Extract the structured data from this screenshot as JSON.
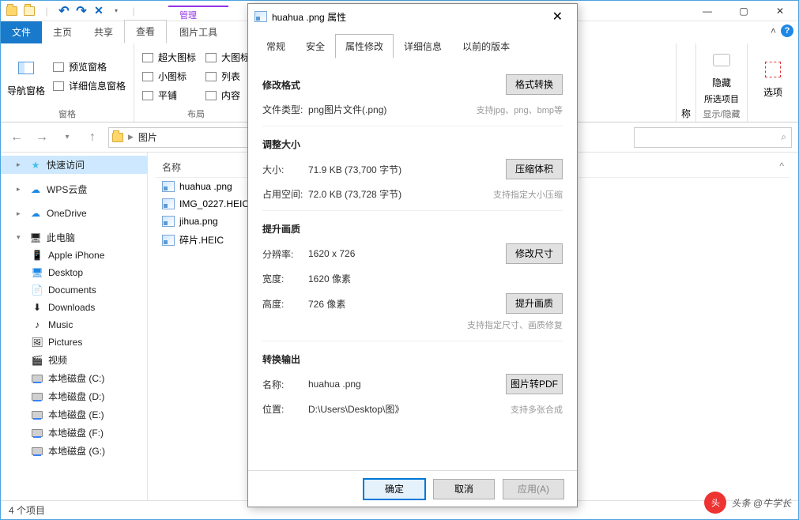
{
  "titlebar": {
    "manage_header": "管理"
  },
  "ribbon": {
    "file": "文件",
    "home": "主页",
    "share": "共享",
    "view": "查看",
    "picture_tools": "图片工具",
    "nav_pane": "导航窗格",
    "preview_pane": "预览窗格",
    "details_pane": "详细信息窗格",
    "panes_label": "窗格",
    "extra_large": "超大图标",
    "large_icons": "大图标",
    "small_icons": "小图标",
    "list": "列表",
    "tiles": "平铺",
    "content": "内容",
    "layout_label": "布局",
    "hide": "隐藏",
    "hide_selected": "所选项目",
    "hide_label": "显示/隐藏",
    "options": "选项",
    "ribbon_right_label": "称"
  },
  "nav": {
    "location": "图片",
    "refresh": "↻"
  },
  "search": {
    "icon": "⌕"
  },
  "tree": {
    "quick_access": "快速访问",
    "wps_cloud": "WPS云盘",
    "onedrive": "OneDrive",
    "this_pc": "此电脑",
    "apple": "Apple iPhone",
    "desktop": "Desktop",
    "documents": "Documents",
    "downloads": "Downloads",
    "music": "Music",
    "pictures": "Pictures",
    "videos": "视频",
    "drive_c": "本地磁盘 (C:)",
    "drive_d": "本地磁盘 (D:)",
    "drive_e": "本地磁盘 (E:)",
    "drive_f": "本地磁盘 (F:)",
    "drive_g": "本地磁盘 (G:)"
  },
  "files": {
    "col_name": "名称",
    "items": [
      "huahua .png",
      "IMG_0227.HEIC",
      "jihua.png",
      "碎片.HEIC"
    ]
  },
  "status": {
    "count": "4 个项目"
  },
  "dialog": {
    "title": "huahua .png 属性",
    "tabs": {
      "general": "常规",
      "security": "安全",
      "modify": "属性修改",
      "details": "详细信息",
      "previous": "以前的版本"
    },
    "sec_format": "修改格式",
    "file_type_label": "文件类型:",
    "file_type": "png图片文件(.png)",
    "format_hint": "支持jpg、png、bmp等",
    "btn_format": "格式转换",
    "sec_resize": "调整大小",
    "size_label": "大小:",
    "size_value": "71.9 KB (73,700 字节)",
    "ondisk_label": "占用空间:",
    "ondisk_value": "72.0 KB (73,728 字节)",
    "btn_compress": "压缩体积",
    "compress_hint": "支持指定大小压缩",
    "sec_quality": "提升画质",
    "res_label": "分辨率:",
    "res_value": "1620 x 726",
    "width_label": "宽度:",
    "width_value": "1620 像素",
    "height_label": "高度:",
    "height_value": "726 像素",
    "btn_resize": "修改尺寸",
    "btn_enhance": "提升画质",
    "quality_hint": "支持指定尺寸、画质修复",
    "sec_output": "转换输出",
    "name_label": "名称:",
    "name_value": "huahua .png",
    "loc_label": "位置:",
    "loc_value": "D:\\Users\\Desktop\\图》",
    "btn_pdf": "图片转PDF",
    "output_hint": "支持多张合成",
    "ok": "确定",
    "cancel": "取消",
    "apply": "应用(A)"
  },
  "watermark": {
    "text": "头条 @牛学长"
  }
}
